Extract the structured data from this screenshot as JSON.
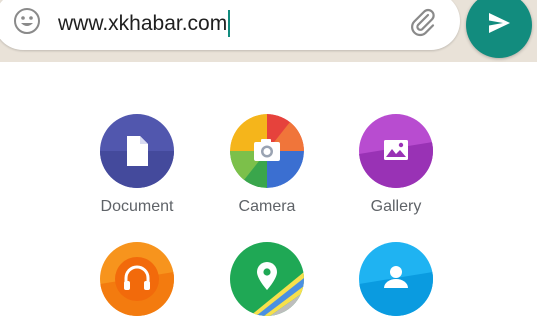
{
  "composer": {
    "message_text": "www.xkhabar.com",
    "emoji_icon": "emoji-smile-icon",
    "attach_icon": "paperclip-icon",
    "send_icon": "send-arrow-icon"
  },
  "attachments": {
    "items": [
      {
        "label": "Document",
        "icon": "document-icon",
        "color": "#5157ae"
      },
      {
        "label": "Camera",
        "icon": "camera-icon",
        "color": "#f4a11a"
      },
      {
        "label": "Gallery",
        "icon": "gallery-icon",
        "color": "#a33cbf"
      },
      {
        "label": "",
        "icon": "headphones-icon",
        "color": "#f5820a"
      },
      {
        "label": "",
        "icon": "location-pin-icon",
        "color": "#1fa855"
      },
      {
        "label": "",
        "icon": "contact-icon",
        "color": "#0ea6ea"
      }
    ]
  },
  "colors": {
    "accent": "#128c7e",
    "background": "#e9e2d8"
  }
}
